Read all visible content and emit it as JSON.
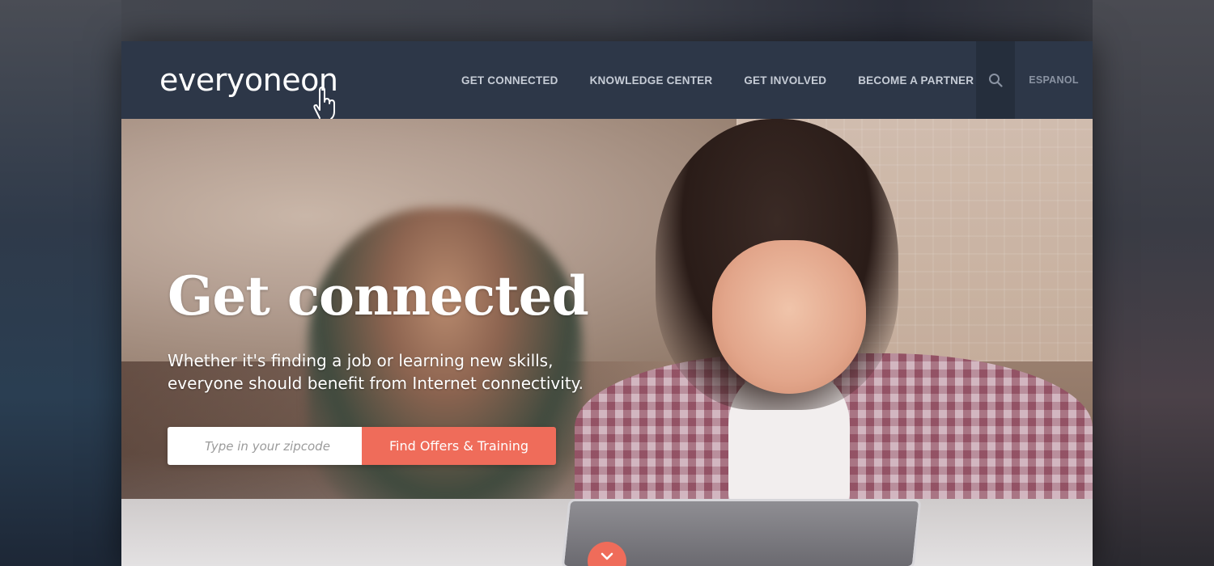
{
  "brand": {
    "logo_text": "everyoneon"
  },
  "nav": {
    "items": [
      {
        "label": "GET CONNECTED"
      },
      {
        "label": "KNOWLEDGE CENTER"
      },
      {
        "label": "GET INVOLVED"
      },
      {
        "label": "BECOME A PARTNER"
      }
    ],
    "search_icon": "search-icon",
    "language_label": "ESPANOL"
  },
  "hero": {
    "title": "Get connected",
    "subtitle": "Whether it's finding a job or learning new skills, everyone should benefit from Internet connectivity.",
    "zip_placeholder": "Type in your zipcode",
    "zip_value": "",
    "cta_label": "Find Offers & Training",
    "scroll_icon": "chevron-down-icon"
  },
  "colors": {
    "nav_bg": "#2d3748",
    "accent": "#ef6c5a",
    "nav_text": "#c6ccd6"
  }
}
